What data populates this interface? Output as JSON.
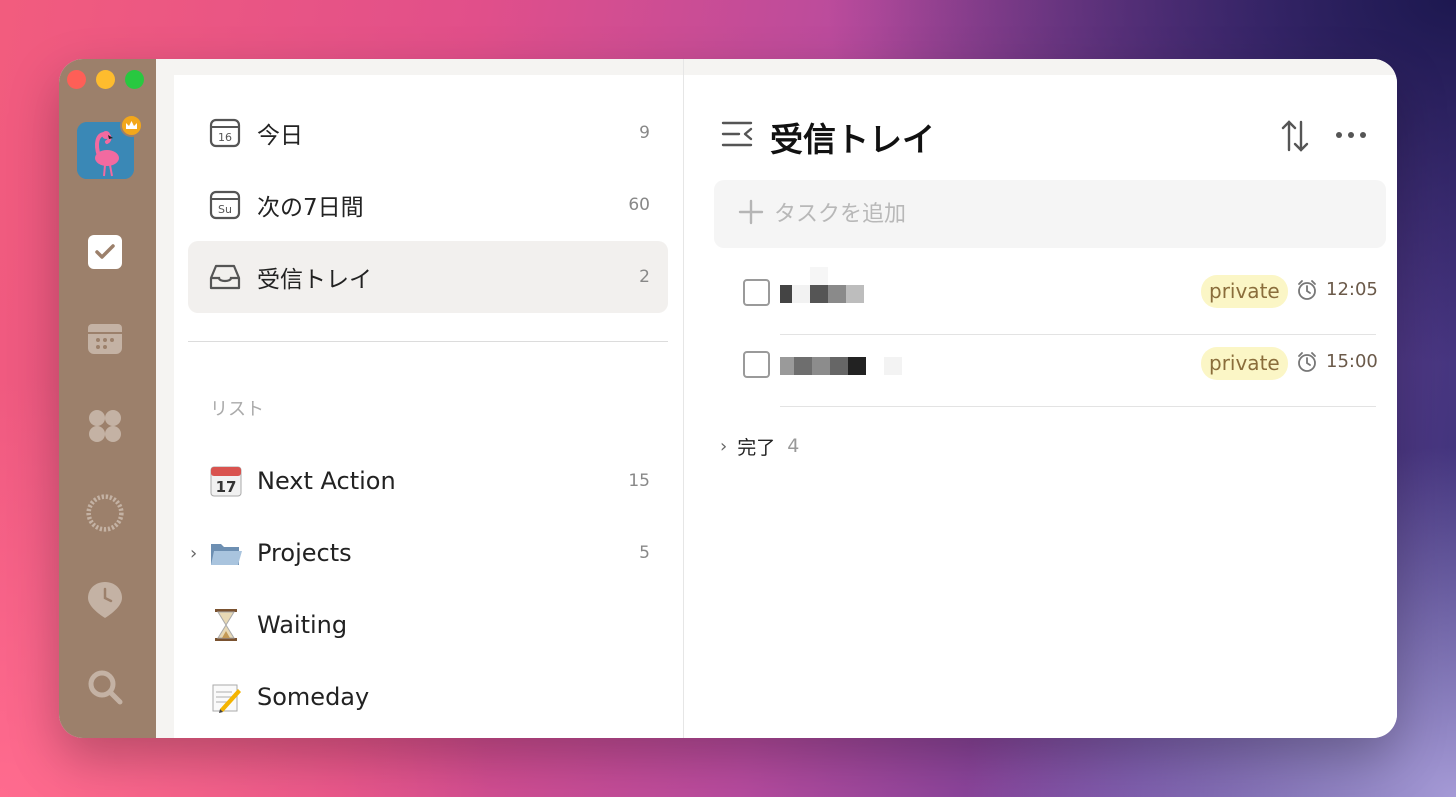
{
  "window_controls": {
    "close_color": "#fe5f57",
    "minimize_color": "#febc2e",
    "zoom_color": "#28c840"
  },
  "rail": {
    "items": [
      {
        "icon": "checkbox-icon",
        "active": true
      },
      {
        "icon": "calendar-icon"
      },
      {
        "icon": "apps-grid-icon"
      },
      {
        "icon": "progress-ring-icon"
      },
      {
        "icon": "clock-pin-icon"
      },
      {
        "icon": "search-icon"
      }
    ]
  },
  "sidebar": {
    "smart_lists": [
      {
        "label": "今日",
        "count": "9",
        "icon": "calendar-16-icon",
        "icon_text": "16"
      },
      {
        "label": "次の7日間",
        "count": "60",
        "icon": "calendar-su-icon",
        "icon_text": "Su"
      },
      {
        "label": "受信トレイ",
        "count": "2",
        "icon": "inbox-tray-icon",
        "active": true
      }
    ],
    "section_label": "リスト",
    "lists": [
      {
        "label": "Next Action",
        "count": "15",
        "emoji": "📆"
      },
      {
        "label": "Projects",
        "count": "5",
        "emoji": "📂",
        "expandable": true
      },
      {
        "label": "Waiting",
        "count": "",
        "emoji": "⏳"
      },
      {
        "label": "Someday",
        "count": "",
        "emoji": "📝"
      }
    ]
  },
  "main": {
    "title": "受信トレイ",
    "add_task_placeholder": "タスクを追加",
    "tasks": [
      {
        "tag": "private",
        "time": "12:05"
      },
      {
        "tag": "private",
        "time": "15:00"
      }
    ],
    "completed": {
      "label": "完了",
      "count": "4"
    }
  },
  "colors": {
    "rail_bg": "#9c806b",
    "tag_bg": "#fbf6c6",
    "tag_text": "#8a6d3b"
  }
}
